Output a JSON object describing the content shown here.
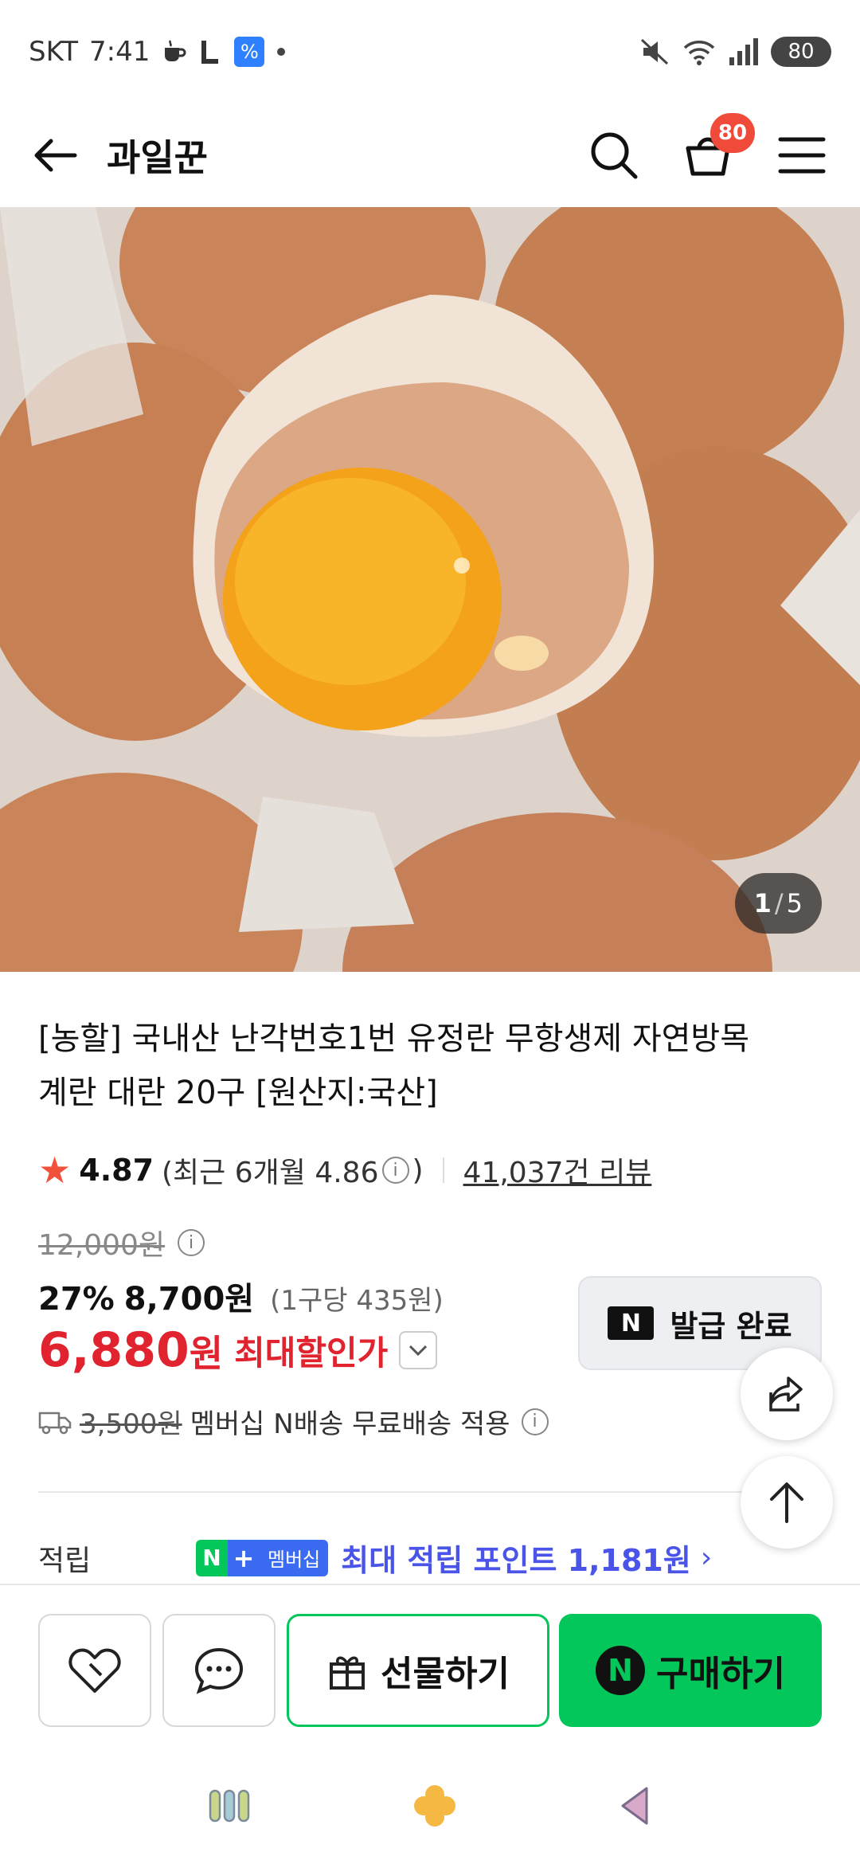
{
  "status_bar": {
    "carrier": "SKT",
    "time": "7:41",
    "signal_label": "5",
    "battery": "80"
  },
  "header": {
    "store_name": "과일꾼",
    "cart_count": "80"
  },
  "image": {
    "current": "1",
    "separator": "/",
    "total": "5"
  },
  "product": {
    "title": "[농할] 국내산 난각번호1번 유정란 무항생제 자연방목 계란 대란 20구 [원산지:국산]",
    "rating": "4.87",
    "recent_rating_prefix": "(최근 6개월 4.86",
    "recent_rating_suffix": ")",
    "review_count": "41,037건 리뷰",
    "original_price": "12,000원",
    "discount_rate": "27%",
    "discount_price": "8,700원",
    "unit_price": "(1구당 435원)",
    "final_price": "6,880",
    "final_unit": "원",
    "max_discount_label": "최대할인가",
    "coupon_label": "발급 완료",
    "shipping_original": "3,500원",
    "shipping_text": "멤버십 N배송 무료배송 적용",
    "points_label": "적립",
    "membership_badge": "멤버십",
    "points_text": "최대 적립 포인트 1,181원"
  },
  "actions": {
    "gift_label": "선물하기",
    "buy_label": "구매하기"
  },
  "colors": {
    "accent_green": "#03c75a",
    "price_red": "#e0232e",
    "points_blue": "#4a54e8",
    "badge_red": "#f04a3a"
  }
}
